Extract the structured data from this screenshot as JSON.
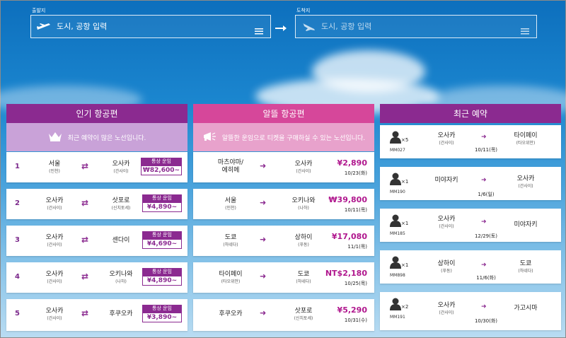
{
  "search": {
    "departure_label": "출발지",
    "departure_placeholder": "도시, 공항 입력",
    "arrival_label": "도착지",
    "arrival_placeholder": "도시, 공항 입력"
  },
  "popular": {
    "title": "인기 항공편",
    "subtitle": "최근 예약이 많은 노선입니다.",
    "fare_label": "통상 운임",
    "items": [
      {
        "rank": "1",
        "from": "서울",
        "from_code": "(인천)",
        "to": "오사카",
        "to_code": "(간사이)",
        "price": "₩82,600~"
      },
      {
        "rank": "2",
        "from": "오사카",
        "from_code": "(간사이)",
        "to": "삿포로",
        "to_code": "(신치토세)",
        "price": "¥4,890~"
      },
      {
        "rank": "3",
        "from": "오사카",
        "from_code": "(간사이)",
        "to": "센다이",
        "to_code": "",
        "price": "¥4,690~"
      },
      {
        "rank": "4",
        "from": "오사카",
        "from_code": "(간사이)",
        "to": "오키나와",
        "to_code": "(나하)",
        "price": "¥4,890~"
      },
      {
        "rank": "5",
        "from": "오사카",
        "from_code": "(간사이)",
        "to": "후쿠오카",
        "to_code": "",
        "price": "¥3,890~"
      }
    ]
  },
  "deals": {
    "title": "알뜰 항공편",
    "subtitle": "알뜰한 운임으로 티켓을 구매하실 수 있는 노선입니다.",
    "items": [
      {
        "from": "마츠야마/\n에히메",
        "from_code": "",
        "to": "오사카",
        "to_code": "(간사이)",
        "price": "¥2,890",
        "date": "10/23(화)"
      },
      {
        "from": "서울",
        "from_code": "(인천)",
        "to": "오키나와",
        "to_code": "(나하)",
        "price": "₩39,800",
        "date": "10/11(목)"
      },
      {
        "from": "도쿄",
        "from_code": "(하네다)",
        "to": "상하이",
        "to_code": "(푸동)",
        "price": "¥17,080",
        "date": "11/1(목)"
      },
      {
        "from": "타이페이",
        "from_code": "(타오위안)",
        "to": "도쿄",
        "to_code": "(하네다)",
        "price": "NT$2,180",
        "date": "10/25(목)"
      },
      {
        "from": "후쿠오카",
        "from_code": "",
        "to": "삿포로",
        "to_code": "(신치토세)",
        "price": "¥5,290",
        "date": "10/31(수)"
      }
    ]
  },
  "recent": {
    "title": "최근 예약",
    "items": [
      {
        "count": "×5",
        "code": "MM027",
        "from": "오사카",
        "from_code": "(간사이)",
        "to": "타이페이",
        "to_code": "(타오위안)",
        "date": "10/11(목)"
      },
      {
        "count": "×1",
        "code": "MM190",
        "from": "미야자키",
        "from_code": "",
        "to": "오사카",
        "to_code": "(간사이)",
        "date": "1/6(일)"
      },
      {
        "count": "×1",
        "code": "MM185",
        "from": "오사카",
        "from_code": "(간사이)",
        "to": "미야자키",
        "to_code": "",
        "date": "12/29(토)"
      },
      {
        "count": "×1",
        "code": "MM898",
        "from": "상하이",
        "from_code": "(푸동)",
        "to": "도쿄",
        "to_code": "(하네다)",
        "date": "11/6(화)"
      },
      {
        "count": "×2",
        "code": "MM191",
        "from": "오사카",
        "from_code": "(간사이)",
        "to": "가고시마",
        "to_code": "",
        "date": "10/30(화)"
      }
    ]
  },
  "colors": {
    "popular_head": "#8b2a90",
    "popular_sub": "#c8a0d6",
    "deals_head": "#d9479a",
    "deals_sub": "#e6a0cc",
    "recent_head": "#8b2a90"
  }
}
